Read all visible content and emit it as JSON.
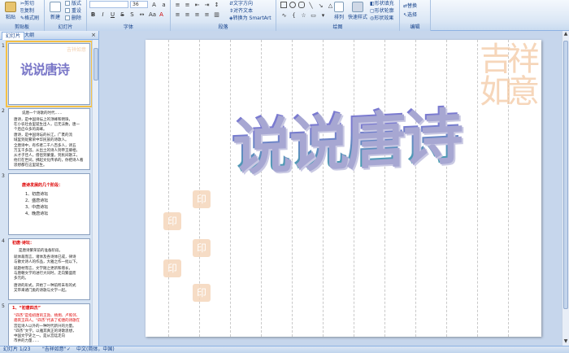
{
  "ribbon": {
    "clipboard": {
      "label": "剪贴板",
      "paste": "粘贴",
      "cut": "剪切",
      "copy": "复制",
      "format_painter": "格式刷"
    },
    "slides": {
      "label": "幻灯片",
      "new_slide": "新建",
      "layout": "版式",
      "reset": "重设",
      "delete": "删除"
    },
    "font": {
      "label": "字体",
      "font_size": "36"
    },
    "paragraph": {
      "label": "段落",
      "text_direction": "文字方向",
      "align_text": "对齐文本",
      "convert_smartart": "转换为 SmartArt"
    },
    "drawing": {
      "label": "绘图",
      "arrange": "排列",
      "quick_styles": "快速样式",
      "shape_fill": "形状填充",
      "shape_outline": "形状轮廓",
      "shape_effects": "形状效果"
    },
    "editing": {
      "label": "编辑",
      "replace": "替换",
      "select": "选择"
    }
  },
  "pane": {
    "tab_slides": "幻灯片",
    "tab_outline": "大纲",
    "close": "×",
    "thumbnails": [
      {
        "number": "1",
        "title": "说说唐诗"
      },
      {
        "number": "2",
        "heading": "说唐一个诗歌的时代……",
        "lines": [
          "唐诗，是中国诗坛上的顶峰和明珠，",
          "在小农社会里诞生出人，已无法数，唐一",
          "个后启众多的高峰。",
          "唐诗，是中国诗坛的长江，广袤的流",
          "域里到处繁荣中华民族的诗歌人。",
          "全唐诗中，有作者二千八百多人，诗五",
          "万五千多首。从出土的诗人到帝王卿相，",
          "从才子佳人，僧侣到蒙童，到民间歌工，",
          "他们在世间，拂起文化传承的，你把诗人看",
          "思想都在这里诞生。"
        ]
      },
      {
        "number": "3",
        "heading": "唐诗发展的几个阶段：",
        "items": [
          "1、初唐诗坛",
          "2、盛唐诗坛",
          "3、中唐诗坛",
          "4、晚唐诗坛"
        ]
      },
      {
        "number": "4",
        "heading": "初唐·诗坛：",
        "lines": [
          "是唐诗繁荣前的准备阶段。",
          "就体裁而言，诸体及各诗体已成，律诗",
          "与散文诗人的作品，大雅之作一批以下。",
          "就题材而言，文学随之更新和增长，",
          "与唐朝文学的进行大同时，走向繁盛而",
          "多元的。",
          "唐诗的形式，开始了一种前所未有的式",
          "又带来诸门类的诗歌与文学一起。"
        ]
      },
      {
        "number": "5",
        "heading": "1、“初唐四杰”",
        "lines": [
          "“四杰”是指初唐的王勃、杨炯、卢照邻、",
          "骆宾王四人。“四杰”代表了初唐的诗歌在",
          "宫廷诗人以外的一种时代新兴的力量。",
          "“四杰”文学，以雅其真正的诗歌思想，",
          "中国文学史之一。是从宫廷走向",
          "市井的力量……"
        ]
      }
    ]
  },
  "slide": {
    "title": "说说唐诗",
    "calligraphy": "吉祥如意"
  },
  "status": {
    "slide_index": "幻灯片 1/23",
    "theme": "\"吉祥如意\"",
    "language": "中文(简体，中国)"
  }
}
